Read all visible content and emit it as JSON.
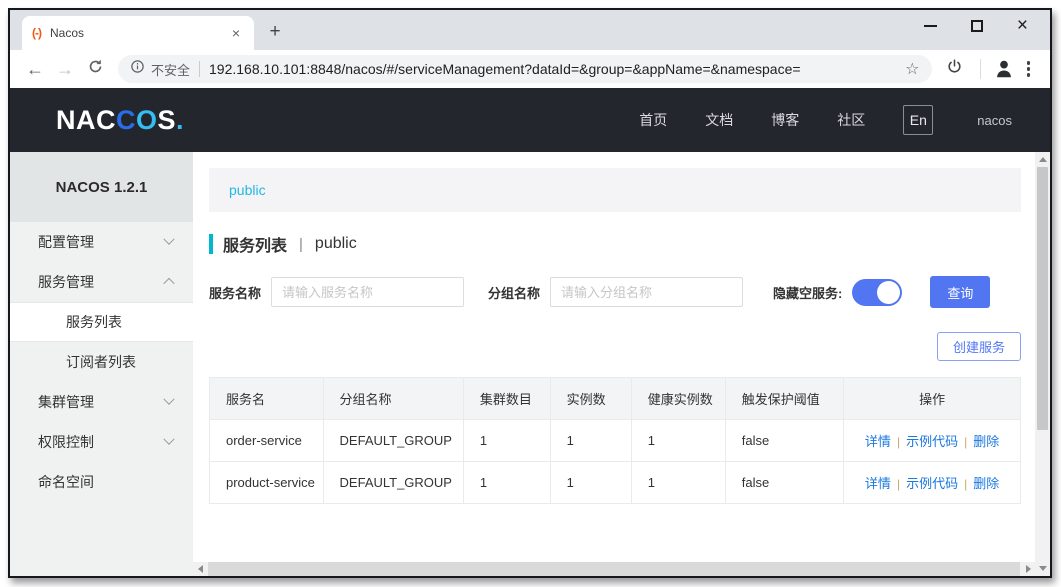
{
  "browser": {
    "tab_title": "Nacos",
    "favicon": "(-)",
    "tab_close": "×",
    "new_tab": "+",
    "back": "←",
    "forward": "→",
    "security_label": "不安全",
    "url": "192.168.10.101:8848/nacos/#/serviceManagement?dataId=&group=&appName=&namespace=",
    "star": "☆"
  },
  "header": {
    "logo": {
      "p1": "NAC",
      "p2c": "C",
      "p2o": "O",
      "p3": "S",
      "p4": "."
    },
    "nav": [
      {
        "label": "首页"
      },
      {
        "label": "文档"
      },
      {
        "label": "博客"
      },
      {
        "label": "社区"
      }
    ],
    "lang_button": "En",
    "username": "nacos"
  },
  "sidebar": {
    "version": "NACOS 1.2.1",
    "items": [
      {
        "label": "配置管理"
      },
      {
        "label": "服务管理"
      },
      {
        "label": "服务列表"
      },
      {
        "label": "订阅者列表"
      },
      {
        "label": "集群管理"
      },
      {
        "label": "权限控制"
      },
      {
        "label": "命名空间"
      }
    ]
  },
  "main": {
    "namespace_bar": "public",
    "page_title": "服务列表",
    "title_separator": "|",
    "page_namespace": "public",
    "filters": {
      "service_name_label": "服务名称",
      "service_name_placeholder": "请输入服务名称",
      "group_name_label": "分组名称",
      "group_name_placeholder": "请输入分组名称",
      "hide_empty_label": "隐藏空服务:",
      "toggle_state": "on",
      "query_button": "查询",
      "create_button": "创建服务"
    },
    "table": {
      "headers": [
        "服务名",
        "分组名称",
        "集群数目",
        "实例数",
        "健康实例数",
        "触发保护阈值",
        "操作"
      ],
      "action_separator": "|",
      "rows": [
        {
          "service": "order-service",
          "group": "DEFAULT_GROUP",
          "clusters": "1",
          "instances": "1",
          "healthy": "1",
          "threshold": "false",
          "actions": [
            "详情",
            "示例代码",
            "删除"
          ]
        },
        {
          "service": "product-service",
          "group": "DEFAULT_GROUP",
          "clusters": "1",
          "instances": "1",
          "healthy": "1",
          "threshold": "false",
          "actions": [
            "详情",
            "示例代码",
            "删除"
          ]
        }
      ]
    }
  },
  "colors": {
    "accent_blue": "#5276f2",
    "namespace_cyan": "#22b7e5",
    "title_bar_teal": "#00b7d0",
    "link_blue": "#1a78e0",
    "header_dark": "#23262d",
    "favicon_orange": "#f0570f"
  }
}
